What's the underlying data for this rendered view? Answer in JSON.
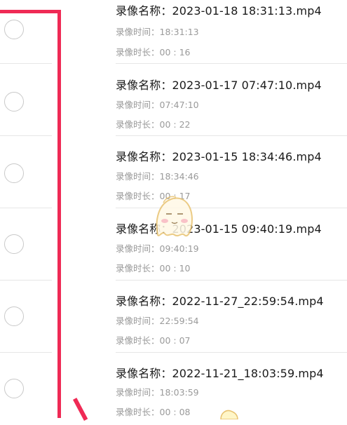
{
  "colors": {
    "highlight": "#ef2a55",
    "title_text": "#1a1a1a",
    "meta_text": "#9a9a9a",
    "divider": "#e6e6e6"
  },
  "recordings": [
    {
      "name": "录像名称：2023-01-18 18:31:13.mp4",
      "time": "录像时间：18:31:13",
      "duration": "录像时长：00 : 16"
    },
    {
      "name": "录像名称：2023-01-17 07:47:10.mp4",
      "time": "录像时间：07:47:10",
      "duration": "录像时长：00 : 22"
    },
    {
      "name": "录像名称：2023-01-15 18:34:46.mp4",
      "time": "录像时间：18:34:46",
      "duration": "录像时长：00 : 17"
    },
    {
      "name": "录像名称：2023-01-15 09:40:19.mp4",
      "time": "录像时间：09:40:19",
      "duration": "录像时长：00 : 10"
    },
    {
      "name": "录像名称：2022-11-27_22:59:54.mp4",
      "time": "录像时间：22:59:54",
      "duration": "录像时长：00 : 07"
    },
    {
      "name": "录像名称：2022-11-21_18:03:59.mp4",
      "time": "录像时间：18:03:59",
      "duration": "录像时长：00 : 08"
    }
  ]
}
